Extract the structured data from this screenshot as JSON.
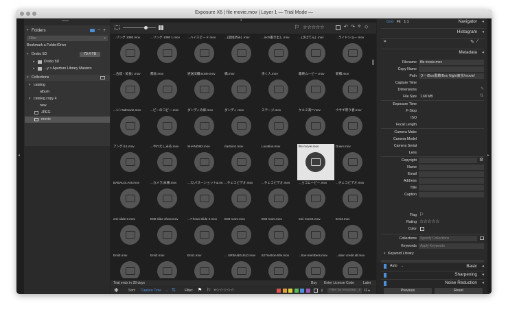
{
  "window": {
    "title": "Exposure X6 | file movie.mov | Layer 1 — Trial Mode —"
  },
  "left": {
    "folders_header": "Folders",
    "filter_placeholder": "Filter",
    "bookmark": "Bookmark a Folder/Drive",
    "drive_name": "Drobo 5D",
    "drive_size": "70.4 TB",
    "folder1": "Drobo 5D",
    "folder2": "...y > Aperture Library Masters",
    "collections_header": "Collections",
    "catalog": "catalog",
    "album": "album",
    "catalog_copy": "catalog copy 4",
    "new": "new",
    "jpeg": "JPEG",
    "movie": "movie"
  },
  "grid": {
    "labels": [
      "...リング 1080.mov",
      "...リング 1080 1.mov",
      "...ハイスピード.mov",
      "...(変換済み) .mov",
      "...inch書き出し.mov",
      "...(さばてん) .mov",
      "...ライドショー.mov",
      "...合成・延長) .mov",
      "都会.mov",
      "逆送法撮movie.mov",
      "橋.mov",
      "歩く人.mov",
      "最終ムービー.mov",
      "新橋.mov",
      "...シン5dmovie.mov",
      "...ピーのコピー.mov",
      "ダンディの扉.mov",
      "ダンディ.mov",
      "ステージ.mov",
      "ケルミ海**.mov",
      "ウサギ祭り者.mov",
      "アングル1.mov",
      "...やわたしみあ.mov",
      "SHANGM2.mov",
      "riaction1.mov",
      "Location.mov",
      "file movie.mov",
      "Down.mov",
      "BABALIS.ANI.mov",
      "...カメラ)本番.mov",
      "...ス)バスーショット&.mov",
      "...チェコビデオ.mov",
      "...チェコビデオ.mov",
      "...ョコムービー.mov",
      "...チェコビデオ.mov",
      "emi slide 2.mov",
      "EMI slide show.mov",
      "...7 hosoi slide 2.mov",
      "EMI room.mov",
      "EMI room.mov",
      "emi room1.mov",
      "Emi4.mov",
      "Emi3.mov",
      "Emi2.mov",
      "Emi1.mov",
      "... URBANGUILD.mov",
      "527motion-title.mov",
      "...tion-members.mov",
      "...otion credit all.mov"
    ]
  },
  "trial": {
    "text": "Trial ends in 28 days",
    "buy": "Buy",
    "license": "Enter License Code",
    "later": "Later"
  },
  "bottom": {
    "sort_label": "Sort:",
    "sort_value": "Capture Time",
    "filter_label": "Filter:",
    "search_placeholder": "Filter by metadata",
    "count": "11 ▸"
  },
  "right": {
    "tabs": [
      "Grid",
      "Fit",
      "1:1"
    ],
    "navigator": "Navigator",
    "histogram": "Histogram",
    "metadata": "Metadata",
    "rows": [
      {
        "k": "Filename",
        "v": "file movie.mov",
        "box": true
      },
      {
        "k": "Copy Name",
        "v": "",
        "box": true
      },
      {
        "k": "Path",
        "v": "ラー/Boo書籍/Boo Night東京/movie/",
        "box": true
      },
      {
        "k": "Capture Time",
        "v": "",
        "box": false
      },
      {
        "k": "Dimensions",
        "v": "",
        "box": false
      },
      {
        "k": "File Size",
        "v": "1.68 MB",
        "box": false
      }
    ],
    "rows2": [
      "Exposure Time",
      "F-Stop",
      "ISO",
      "Focal Length"
    ],
    "rows3": [
      "Camera Make",
      "Camera Model",
      "Camera Serial",
      "Lens"
    ],
    "rows4": [
      "Copyright",
      "Name",
      "Email",
      "Address",
      "Title",
      "Caption"
    ],
    "flag": "Flag",
    "rating": "Rating",
    "rating_stars": "☆☆☆☆☆",
    "color": "Color",
    "collections_label": "Collections",
    "collections_placeholder": "Specify Collections",
    "keywords_label": "Keywords",
    "keywords_placeholder": "Apply Keywords",
    "keyword_library": "Keyword Library",
    "auto": "Auto",
    "basic": "Basic",
    "sharpening": "Sharpening",
    "noise": "Noise Reduction",
    "previous": "Previous",
    "reset": "Reset"
  },
  "colors": {
    "accent": "#4a90d9",
    "selected_tile": "#e4e4e4",
    "swatches": [
      "#d9534f",
      "#e0a030",
      "#e0d040",
      "#5cb85c",
      "#4a90d9",
      "#9b59b6"
    ]
  }
}
